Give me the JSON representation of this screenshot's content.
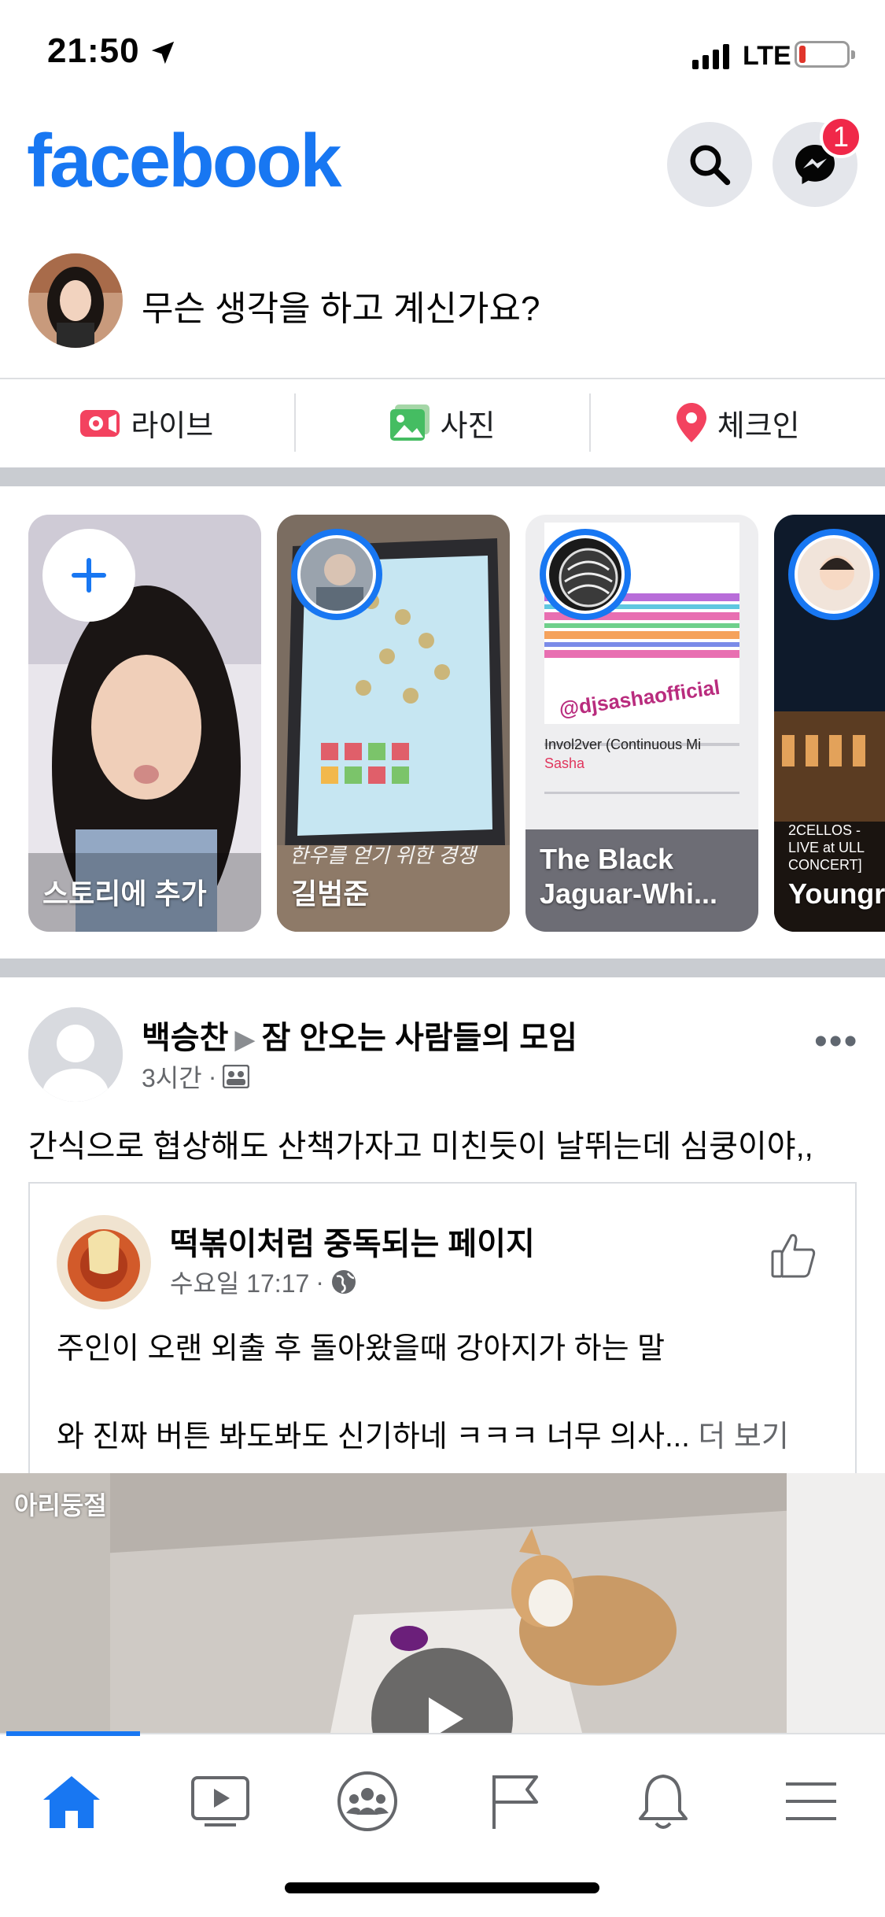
{
  "status_bar": {
    "time": "21:50",
    "network": "LTE"
  },
  "header": {
    "logo": "facebook",
    "notification_count": "1",
    "brand_color": "#1877f2",
    "badge_color": "#f02849"
  },
  "composer": {
    "prompt": "무슨 생각을 하고 계신가요?",
    "actions": [
      {
        "label": "라이브",
        "icon": "live-video-icon",
        "color": "#f3425f"
      },
      {
        "label": "사진",
        "icon": "photo-icon",
        "color": "#45bd62"
      },
      {
        "label": "체크인",
        "icon": "location-pin-icon",
        "color": "#f3425f"
      }
    ]
  },
  "stories": [
    {
      "label": "스토리에 추가",
      "type": "add"
    },
    {
      "label": "길범준",
      "overlay_text": "한우를 얻기 위한 경쟁"
    },
    {
      "label": "The Black Jaguar-Whi...",
      "handle": "@djsashaofficial",
      "track": "Invol2ver (Continuous Mi",
      "artist": "Sasha"
    },
    {
      "label": "Youngr",
      "overlay_text": "2CELLOS - LIVE at ULL CONCERT]"
    }
  ],
  "post": {
    "author": "백승찬",
    "group": "잠 안오는 사람들의 모임",
    "time": "3시간",
    "text": "간식으로 협상해도 산책가자고 미친듯이 날뛰는데 심쿵이야,,",
    "shared": {
      "page_name": "떡볶이처럼 중독되는 페이지",
      "time": "수요일 17:17",
      "line1": "주인이 오랜 외출 후 돌아왔을때 강아지가 하는 말",
      "line2": "와 진짜 버튼 봐도봐도 신기하네 ㅋㅋㅋ 너무 의사...",
      "see_more": "더 보기"
    },
    "video_watermark": "아리둥절"
  },
  "tab_bar": {
    "tabs": [
      "home-icon",
      "watch-icon",
      "groups-icon",
      "pages-flag-icon",
      "notifications-bell-icon",
      "menu-icon"
    ],
    "active": "home-icon"
  }
}
